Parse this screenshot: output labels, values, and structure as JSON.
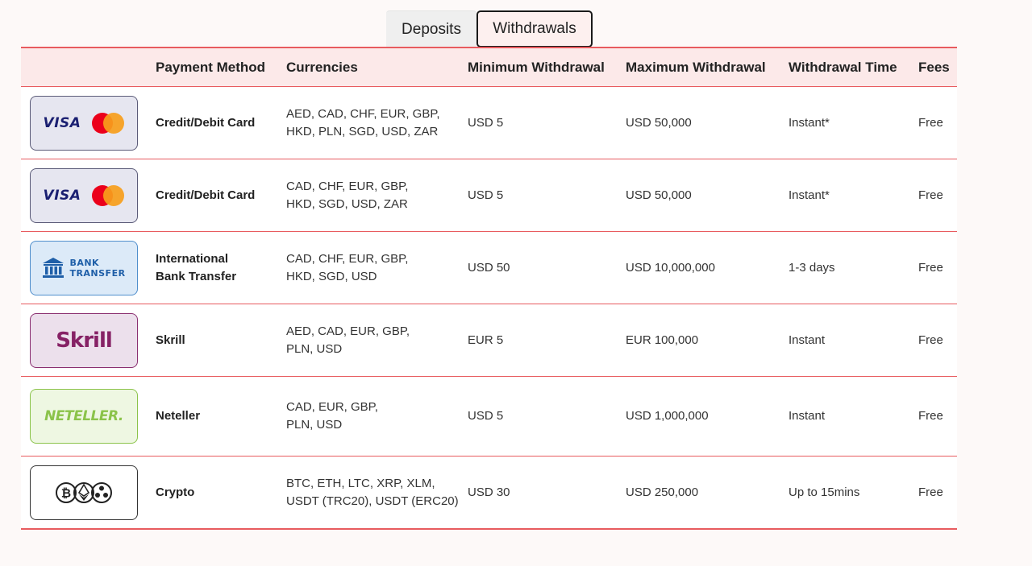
{
  "tabs": {
    "deposits": "Deposits",
    "withdrawals": "Withdrawals",
    "active": "withdrawals"
  },
  "table": {
    "headers": {
      "payment_method": "Payment Method",
      "currencies": "Currencies",
      "minimum": "Minimum Withdrawal",
      "maximum": "Maximum Withdrawal",
      "time": "Withdrawal Time",
      "fees": "Fees"
    },
    "rows": [
      {
        "logo": "visa-mastercard-logo",
        "logo_text": "VISA",
        "method": "Credit/Debit Card",
        "currencies_line1": "AED, CAD, CHF, EUR, GBP,",
        "currencies_line2": "HKD, PLN, SGD, USD, ZAR",
        "min": "USD 5",
        "max": "USD 50,000",
        "time": "Instant*",
        "fees": "Free"
      },
      {
        "logo": "visa-mastercard-logo",
        "logo_text": "VISA",
        "method": "Credit/Debit Card",
        "currencies_line1": "CAD, CHF, EUR, GBP,",
        "currencies_line2": "HKD, SGD, USD, ZAR",
        "min": "USD 5",
        "max": "USD 50,000",
        "time": "Instant*",
        "fees": "Free"
      },
      {
        "logo": "bank-transfer-logo",
        "logo_text_line1": "BANK",
        "logo_text_line2": "TRANSFER",
        "method_line1": "International",
        "method_line2": "Bank Transfer",
        "currencies_line1": "CAD, CHF, EUR, GBP,",
        "currencies_line2": "HKD, SGD, USD",
        "min": "USD 50",
        "max": "USD 10,000,000",
        "time": "1-3 days",
        "fees": "Free"
      },
      {
        "logo": "skrill-logo",
        "logo_text": "Skrill",
        "method": "Skrill",
        "currencies_line1": "AED, CAD, EUR, GBP,",
        "currencies_line2": "PLN, USD",
        "min": "EUR 5",
        "max": "EUR 100,000",
        "time": "Instant",
        "fees": "Free"
      },
      {
        "logo": "neteller-logo",
        "logo_text": "NETELLER.",
        "method": "Neteller",
        "currencies_line1": "CAD, EUR, GBP,",
        "currencies_line2": "PLN, USD",
        "min": "USD 5",
        "max": "USD 1,000,000",
        "time": "Instant",
        "fees": "Free"
      },
      {
        "logo": "crypto-logo",
        "method": "Crypto",
        "currencies_line1": "BTC, ETH, LTC, XRP, XLM,",
        "currencies_line2": "USDT (TRC20), USDT (ERC20)",
        "min": "USD 30",
        "max": "USD 250,000",
        "time": "Up to 15mins",
        "fees": "Free"
      }
    ]
  },
  "colors": {
    "accent_red": "#e85b5f",
    "header_bg": "#fce9e9",
    "visa_blue": "#1a1f71",
    "mastercard_red": "#eb001b",
    "mastercard_orange": "#f79e1b",
    "skrill_purple": "#862165",
    "neteller_green": "#8bc34a",
    "bank_blue": "#1f5fa8"
  }
}
